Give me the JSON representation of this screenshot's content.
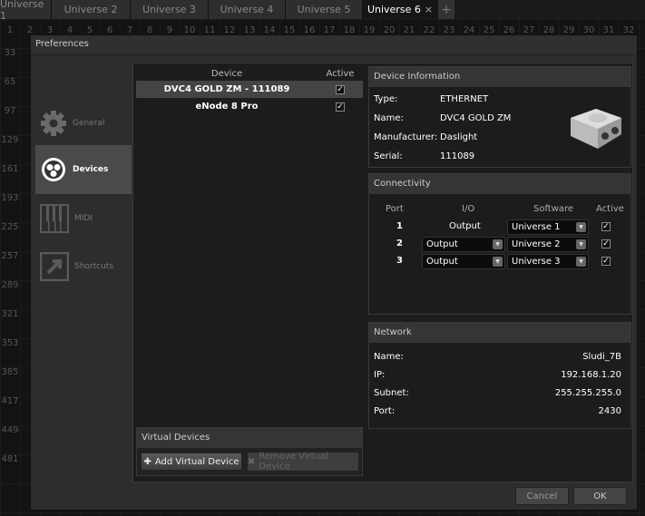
{
  "tabs": [
    {
      "label": "Universe 1"
    },
    {
      "label": "Universe 2"
    },
    {
      "label": "Universe 3"
    },
    {
      "label": "Universe 4"
    },
    {
      "label": "Universe 5"
    },
    {
      "label": "Universe 6",
      "active": true
    }
  ],
  "tab_close": "×",
  "tab_add": "+",
  "grid": {
    "columns": [
      "1",
      "2",
      "3",
      "4",
      "5",
      "6",
      "7",
      "8",
      "9",
      "10",
      "11",
      "12",
      "13",
      "14",
      "15",
      "16",
      "17",
      "18",
      "19",
      "20",
      "21",
      "22",
      "23",
      "24",
      "25",
      "26",
      "27",
      "28",
      "29",
      "30",
      "31",
      "32"
    ],
    "rows": [
      "33",
      "65",
      "97",
      "129",
      "161",
      "193",
      "225",
      "257",
      "289",
      "321",
      "353",
      "385",
      "417",
      "449",
      "481"
    ]
  },
  "dialog": {
    "title": "Preferences",
    "sidebar": [
      {
        "label": "General",
        "icon": "gear-icon"
      },
      {
        "label": "Devices",
        "icon": "devices-icon",
        "selected": true
      },
      {
        "label": "MIDI",
        "icon": "piano-icon"
      },
      {
        "label": "Shortcuts",
        "icon": "shortcut-arrow-icon"
      }
    ],
    "devices": {
      "col_device": "Device",
      "col_active": "Active",
      "rows": [
        {
          "name": "DVC4 GOLD ZM - 111089",
          "active": true,
          "selected": true
        },
        {
          "name": "eNode 8 Pro",
          "active": true
        }
      ]
    },
    "virtual": {
      "title": "Virtual Devices",
      "add": "Add Virtual Device",
      "remove": "Remove Virtual Device"
    },
    "info": {
      "title": "Device Information",
      "rows": [
        {
          "k": "Type:",
          "v": "ETHERNET"
        },
        {
          "k": "Name:",
          "v": "DVC4 GOLD ZM"
        },
        {
          "k": "Manufacturer:",
          "v": "Daslight"
        },
        {
          "k": "Serial:",
          "v": "111089"
        }
      ]
    },
    "conn": {
      "title": "Connectivity",
      "col_port": "Port",
      "col_io": "I/O",
      "col_sw": "Software",
      "col_active": "Active",
      "rows": [
        {
          "port": "1",
          "io": "Output",
          "io_dropdown": false,
          "sw": "Universe 1",
          "active": true
        },
        {
          "port": "2",
          "io": "Output",
          "io_dropdown": true,
          "sw": "Universe 2",
          "active": true
        },
        {
          "port": "3",
          "io": "Output",
          "io_dropdown": true,
          "sw": "Universe 3",
          "active": true
        }
      ]
    },
    "network": {
      "title": "Network",
      "rows": [
        {
          "k": "Name:",
          "v": "Sludi_7B"
        },
        {
          "k": "IP:",
          "v": "192.168.1.20"
        },
        {
          "k": "Subnet:",
          "v": "255.255.255.0"
        },
        {
          "k": "Port:",
          "v": "2430"
        }
      ]
    },
    "cancel": "Cancel",
    "ok": "OK"
  }
}
